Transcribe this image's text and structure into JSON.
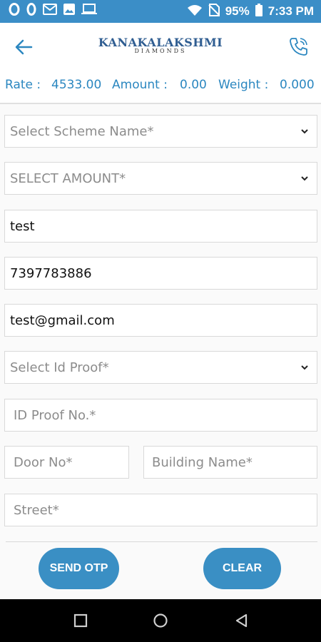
{
  "status_bar": {
    "time": "7:33 PM",
    "battery": "95%",
    "icons": [
      "opera-icon",
      "opera-icon",
      "gmail-icon",
      "gallery-icon",
      "laptop-icon",
      "wifi-icon",
      "no-sim-icon",
      "battery-icon"
    ]
  },
  "header": {
    "brand_main": "KANAKALAKSHMI",
    "brand_sub": "DIAMONDS",
    "back_icon": "back-arrow-icon",
    "phone_icon": "phone-icon"
  },
  "rates": {
    "rate_label": "Rate :",
    "rate_value": "4533.00",
    "amount_label": "Amount :",
    "amount_value": "0.00",
    "weight_label": "Weight :",
    "weight_value": "0.000"
  },
  "form": {
    "scheme_placeholder": "Select Scheme Name*",
    "amount_placeholder": "SELECT AMOUNT*",
    "name_value": "test",
    "phone_value": "7397783886",
    "email_value": "test@gmail.com",
    "idproof_placeholder": "Select Id Proof*",
    "idproof_no_placeholder": "ID Proof No.*",
    "door_placeholder": "Door No*",
    "building_placeholder": "Building Name*",
    "street_placeholder": "Street*"
  },
  "actions": {
    "send_otp": "SEND OTP",
    "clear": "CLEAR"
  },
  "colors": {
    "accent": "#3b8ec7",
    "button": "#3a8fc4",
    "brand": "#2f5d91"
  }
}
